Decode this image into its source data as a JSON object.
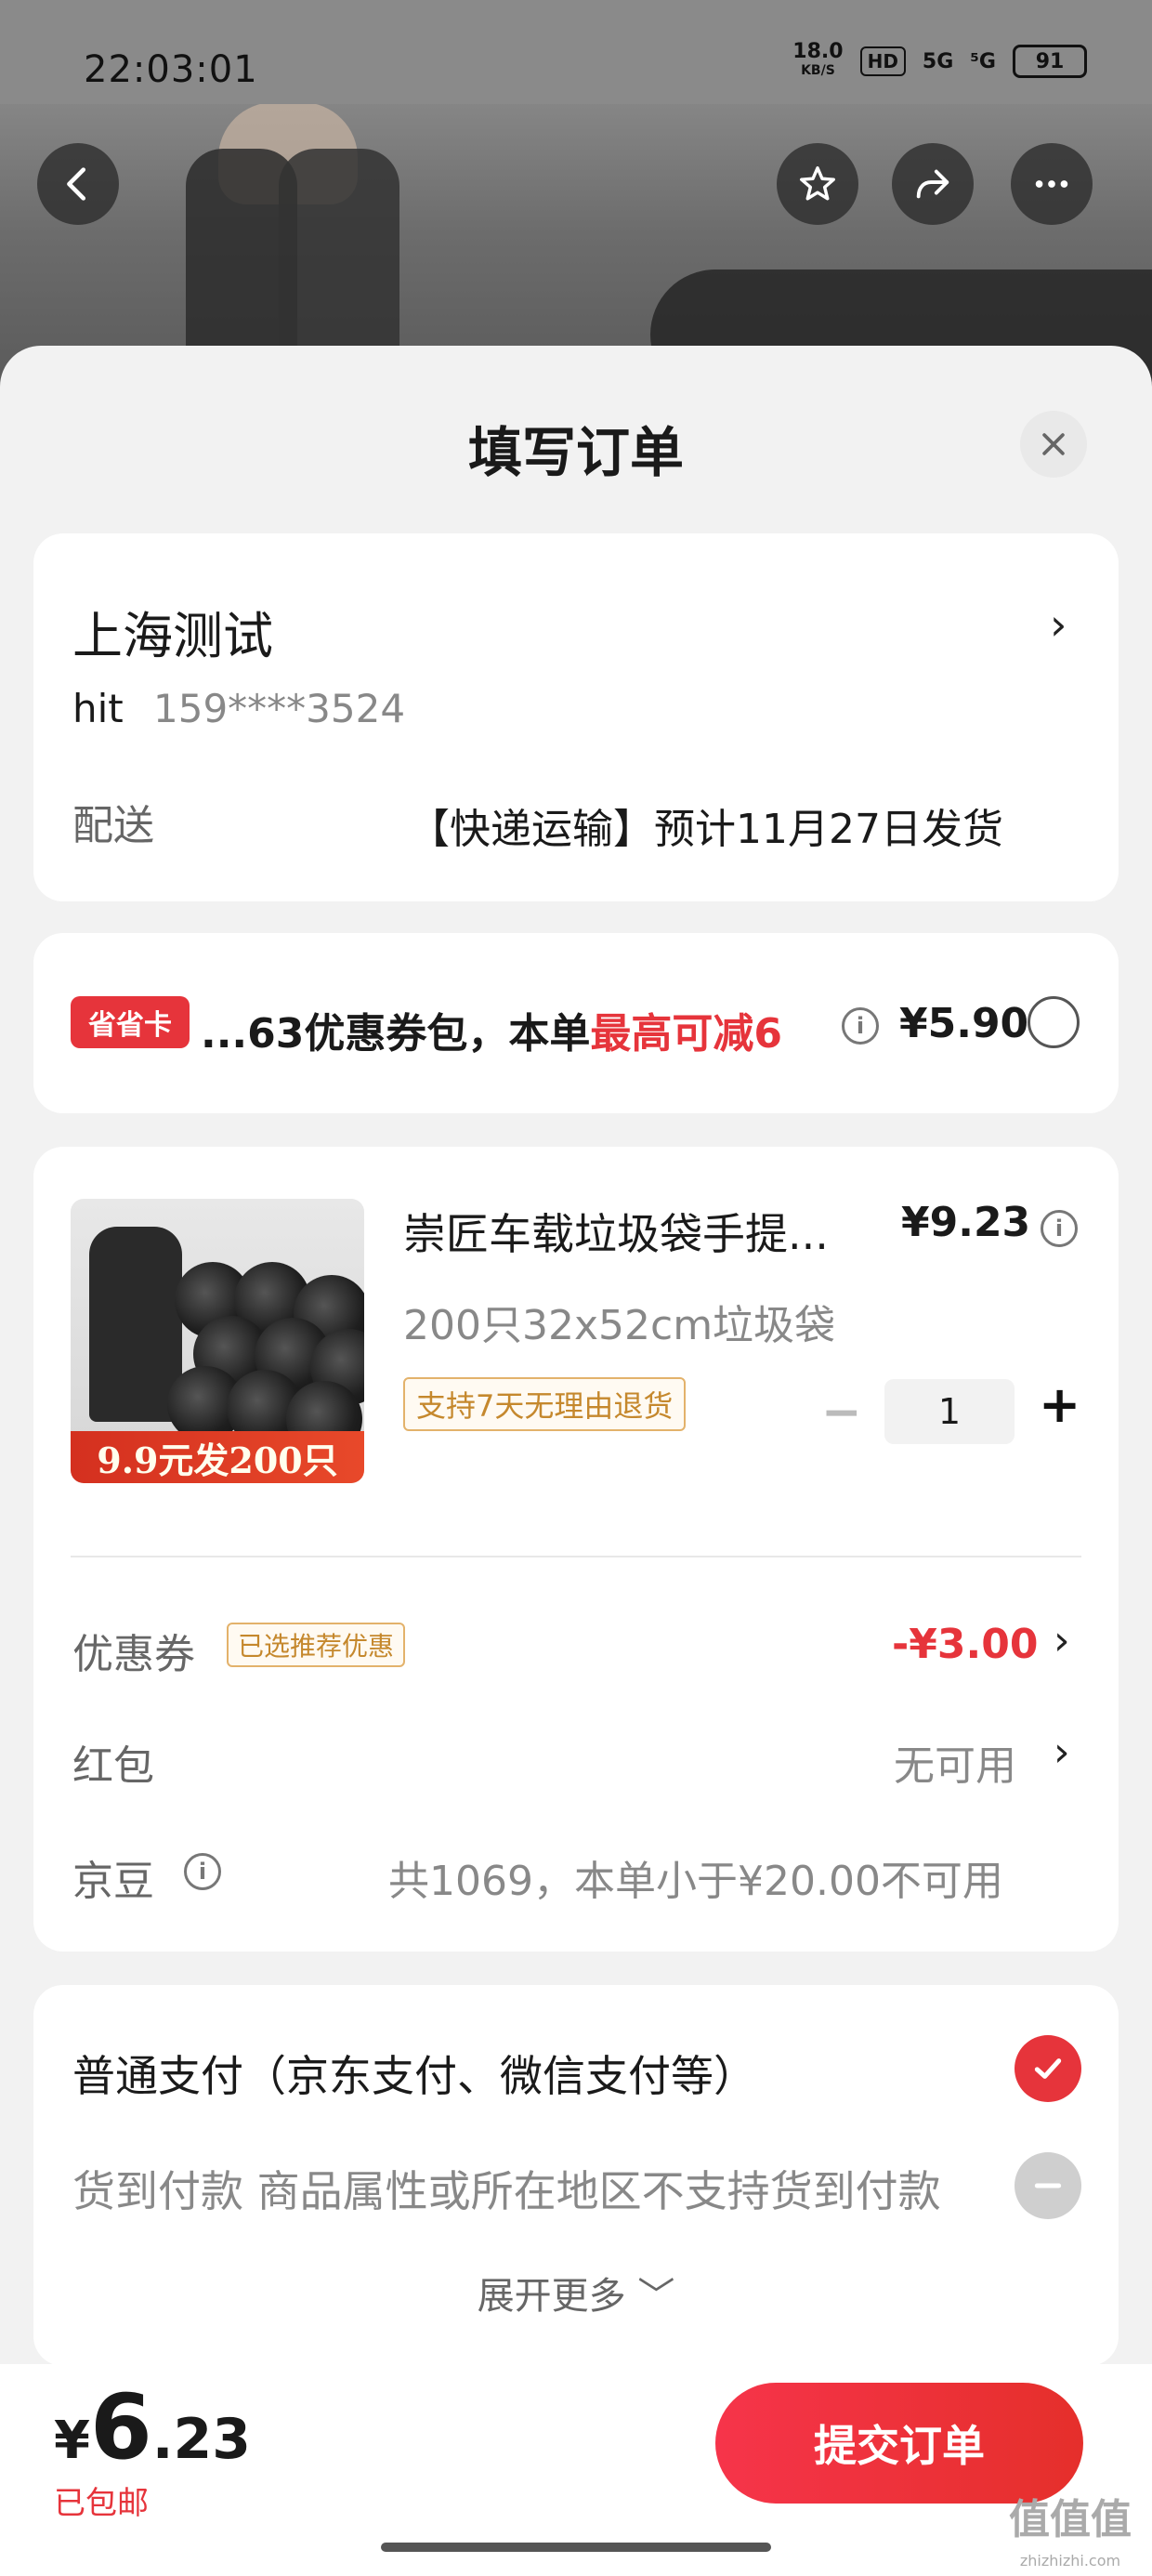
{
  "status_bar": {
    "time": "22:03:01",
    "net_speed": "18.0",
    "net_unit": "KB/S",
    "hd": "HD",
    "sig1": "5G",
    "sig2": "⁵G",
    "battery": "91"
  },
  "nav": {
    "back_icon": "back-arrow-icon",
    "favorite_icon": "star-icon",
    "share_icon": "share-icon",
    "more_icon": "more-icon"
  },
  "sheet": {
    "title": "填写订单",
    "close_icon": "close-icon"
  },
  "address": {
    "name": "上海测试",
    "person": "hit",
    "phone": "159****3524",
    "arrow": "›",
    "shipping_label": "配送",
    "shipping_value": "【快递运输】预计11月27日发货"
  },
  "promo": {
    "badge": "省省卡",
    "text_prefix": "...63优惠券包，本单",
    "text_highlight": "最高可减6",
    "info_icon": "i",
    "price": "¥5.90"
  },
  "product": {
    "image_banner": "9.9元发200只",
    "name": "崇匠车载垃圾袋手提...",
    "price": "¥9.23",
    "info_icon": "i",
    "spec": "200只32x52cm垃圾袋",
    "return_tag": "支持7天无理由退货",
    "qty_minus": "−",
    "quantity": "1",
    "qty_plus": "+"
  },
  "discounts": {
    "coupon_label": "优惠券",
    "coupon_tag": "已选推荐优惠",
    "coupon_value": "-¥3.00",
    "redpack_label": "红包",
    "redpack_value": "无可用",
    "jd_label": "京豆",
    "jd_info_icon": "i",
    "jd_value": "共1069，本单小于¥20.00不可用",
    "arrow": "›"
  },
  "payment": {
    "option1": "普通支付（京东支付、微信支付等）",
    "option2": "货到付款 商品属性或所在地区不支持货到付款",
    "expand": "展开更多 ﹀"
  },
  "footer": {
    "currency": "¥",
    "total_int": "6",
    "total_dec": ".23",
    "shipping": "已包邮",
    "submit": "提交订单"
  },
  "watermark": {
    "big": "值值值",
    "small": "zhizhizhi.com"
  },
  "colors": {
    "accent": "#e6343b",
    "tag_border": "#e3b26b"
  }
}
